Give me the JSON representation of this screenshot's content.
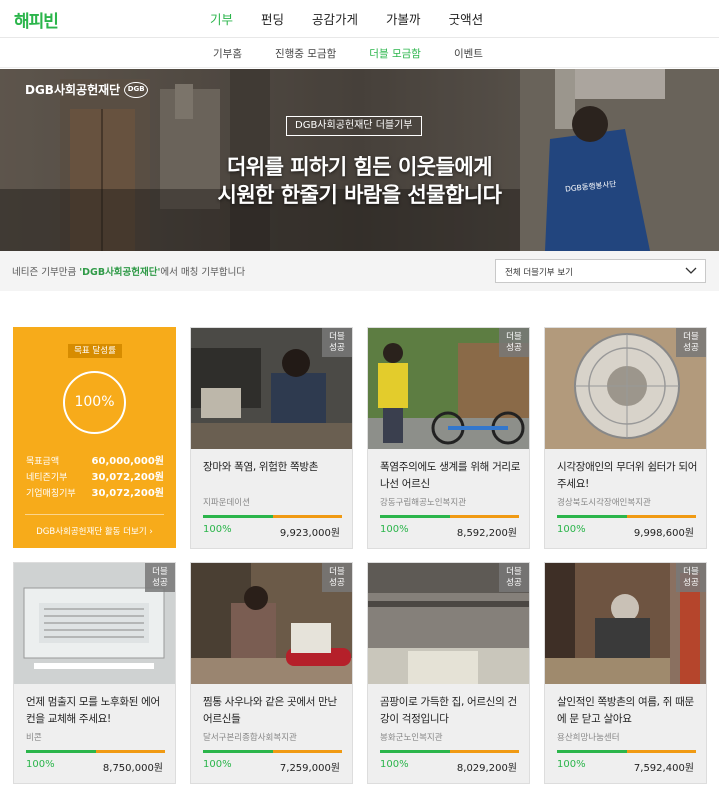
{
  "header": {
    "logo": "해피빈",
    "nav": [
      "기부",
      "펀딩",
      "공감가게",
      "가볼까",
      "굿액션"
    ]
  },
  "subnav": [
    "기부홈",
    "진행중 모금함",
    "더블 모금함",
    "이벤트"
  ],
  "banner": {
    "brand": "DGB사회공헌재단",
    "brand_logo": "DGB",
    "tag": "DGB사회공헌재단 더블기부",
    "headline1": "더위를 피하기 힘든 이웃들에게",
    "headline2": "시원한 한줄기 바람을 선물합니다",
    "vest_text": "DGB동행봉사단"
  },
  "filter": {
    "pre": "네티즌 기부만큼 ",
    "highlight": "'DGB사회공헌재단'",
    "post": "에서 매칭 기부합니다",
    "select": "전체 더블기부 보기"
  },
  "goal": {
    "label": "목표 달성률",
    "rate": "100%",
    "rows": [
      {
        "k": "목표금액",
        "v": "60,000,000원"
      },
      {
        "k": "네티즌기부",
        "v": "30,072,200원"
      },
      {
        "k": "기업매칭기부",
        "v": "30,072,200원"
      }
    ],
    "link": "DGB사회공헌재단 활동 더보기 ›"
  },
  "badge": {
    "line1": "더블",
    "line2": "성공"
  },
  "cards": [
    {
      "title": "장마와 폭염, 위험한 쪽방촌",
      "org": "지파운데이션",
      "pct": "100%",
      "amount": "9,923,000원",
      "progress": 0.5
    },
    {
      "title": "폭염주의에도 생계를 위해 거리로 나선 어르신",
      "org": "강동구립해공노인복지관",
      "pct": "100%",
      "amount": "8,592,200원",
      "progress": 0.5
    },
    {
      "title": "시각장애인의 무더위 쉼터가 되어 주세요!",
      "org": "경상북도시각장애인복지관",
      "pct": "100%",
      "amount": "9,998,600원",
      "progress": 0.5
    },
    {
      "title": "언제 멈출지 모를 노후화된 에어컨을 교체해 주세요!",
      "org": "비콘",
      "pct": "100%",
      "amount": "8,750,000원",
      "progress": 0.5
    },
    {
      "title": "찜통 사우나와 같은 곳에서 만난 어르신들",
      "org": "달서구본리종합사회복지관",
      "pct": "100%",
      "amount": "7,259,000원",
      "progress": 0.5
    },
    {
      "title": "곰팡이로 가득한 집, 어르신의 건강이 걱정입니다",
      "org": "봉화군노인복지관",
      "pct": "100%",
      "amount": "8,029,200원",
      "progress": 0.5
    },
    {
      "title": "살인적인 쪽방촌의 여름, 쥐 때문에 문 닫고 살아요",
      "org": "용산희망나눔센터",
      "pct": "100%",
      "amount": "7,592,400원",
      "progress": 0.5
    }
  ]
}
